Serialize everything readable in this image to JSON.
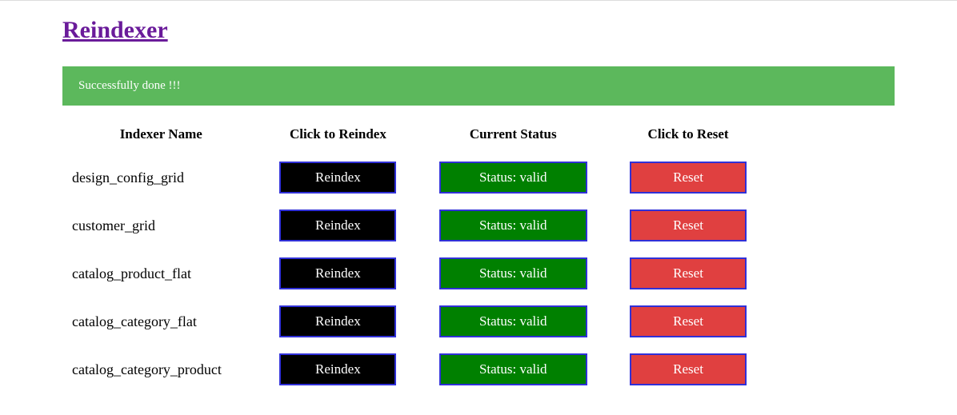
{
  "page": {
    "title": "Reindexer",
    "success_message": "Successfully done !!!"
  },
  "table": {
    "headers": {
      "name": "Indexer Name",
      "reindex": "Click to Reindex",
      "status": "Current Status",
      "reset": "Click to Reset"
    },
    "reindex_label": "Reindex",
    "reset_label": "Reset",
    "status_prefix": "Status: ",
    "rows": [
      {
        "name": "design_config_grid",
        "status": "valid"
      },
      {
        "name": "customer_grid",
        "status": "valid"
      },
      {
        "name": "catalog_product_flat",
        "status": "valid"
      },
      {
        "name": "catalog_category_flat",
        "status": "valid"
      },
      {
        "name": "catalog_category_product",
        "status": "valid"
      }
    ]
  }
}
